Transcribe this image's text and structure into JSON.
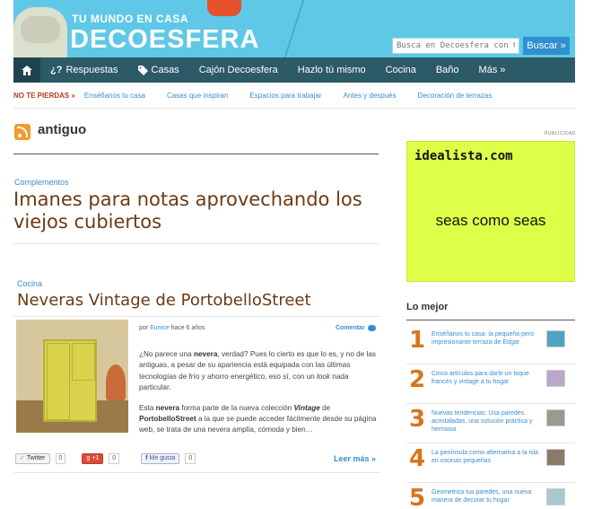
{
  "header": {
    "tagline": "TU MUNDO EN CASA",
    "logo": "DECOESFERA",
    "search_placeholder": "Busca en Decoesfera con Google",
    "search_button": "Buscar »",
    "bg_color": "#5fc8e6"
  },
  "nav": {
    "home_icon": "home-icon",
    "items": [
      {
        "label": "Respuestas",
        "icon": "question-icon"
      },
      {
        "label": "Casas",
        "icon": "tag-icon"
      },
      {
        "label": "Cajón Decoesfera"
      },
      {
        "label": "Hazlo tú mismo"
      },
      {
        "label": "Cocina"
      },
      {
        "label": "Baño"
      },
      {
        "label": "Más »"
      }
    ]
  },
  "subnav": {
    "label": "NO TE PIERDAS »",
    "links": [
      "Enséñanos tu casa",
      "Casas que inspiran",
      "Espacios para trabajar",
      "Antes y después",
      "Decoración de terrazas"
    ]
  },
  "page": {
    "title": "antiguo"
  },
  "posts": [
    {
      "category": "Complementos",
      "title": "Imanes para notas aprovechando los viejos cubiertos"
    },
    {
      "category": "Cocina",
      "title": "Neveras Vintage de PortobelloStreet",
      "byline_prefix": "por",
      "author": "Eunice",
      "date": "hace 6 años",
      "comment_label": "Comentar",
      "excerpt_p1_a": "¿No parece una ",
      "excerpt_p1_b": "nevera",
      "excerpt_p1_c": ", verdad? Pues lo cierto es que lo es, y no de las antiguas, a pesar de su apariencia está equipada con las últimas tecnologías de frío y ahorro energético, eso sí, con un ",
      "excerpt_p1_d": "look",
      "excerpt_p1_e": " nada particular.",
      "excerpt_p2_a": "Esta ",
      "excerpt_p2_b": "nevera",
      "excerpt_p2_c": " forma parte de la nueva colección ",
      "excerpt_p2_d": "Vintage",
      "excerpt_p2_e": " de ",
      "excerpt_p2_f": "PortobelloStreet",
      "excerpt_p2_g": " a la que se puede acceder fácilmente desde su página web, se trata de una nevera amplia, cómoda y bien…",
      "read_more": "Leer más »",
      "share": {
        "twitter_label": "Twitter",
        "twitter_count": "0",
        "gplus_label": "+1",
        "gplus_count": "0",
        "facebook_label": "Me gusta",
        "facebook_count": "0"
      }
    }
  ],
  "sidebar": {
    "ad_label": "PUBLICIDAD",
    "ad_brand": "idealista.com",
    "ad_slogan": "seas como seas",
    "ad_color": "#deff48",
    "best_title": "Lo mejor",
    "best_items": [
      {
        "num": "1",
        "text": "Enséñanos tu casa: la pequeña pero impresionante terraza de Edgar"
      },
      {
        "num": "2",
        "text": "Cinco artículos para darle un toque francés y vintage a tu hogar"
      },
      {
        "num": "3",
        "text": "Nuevas tendencias: Usa paredes acristaladas, una solución práctica y hermosa"
      },
      {
        "num": "4",
        "text": "La península como alternativa a la isla en cocinas pequeñas"
      },
      {
        "num": "5",
        "text": "Geometriza tus paredes, una nueva manera de decorar tu hogar"
      }
    ]
  }
}
